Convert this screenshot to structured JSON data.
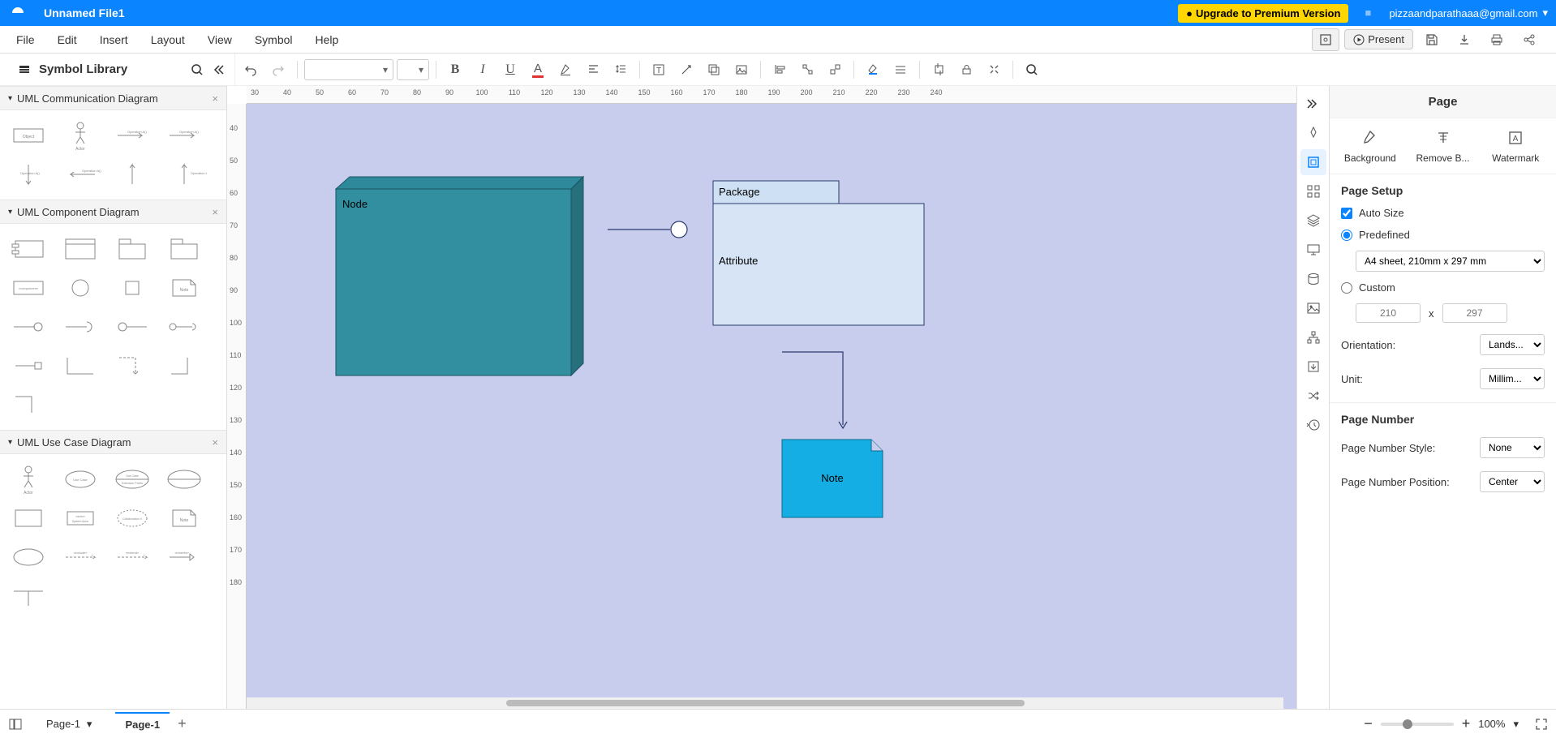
{
  "app": {
    "file_title": "Unnamed File1",
    "upgrade_label": "Upgrade to Premium Version",
    "user_email": "pizzaandparathaaa@gmail.com"
  },
  "menus": [
    "File",
    "Edit",
    "Insert",
    "Layout",
    "View",
    "Symbol",
    "Help"
  ],
  "present_label": "Present",
  "symbol_library_title": "Symbol Library",
  "shape_groups": [
    {
      "title": "UML Communication Diagram"
    },
    {
      "title": "UML Component Diagram"
    },
    {
      "title": "UML Use Case Diagram"
    }
  ],
  "canvas": {
    "ruler_h": [
      30,
      40,
      50,
      60,
      70,
      80,
      90,
      100,
      110,
      120,
      130,
      140,
      150,
      160,
      170,
      180,
      190,
      200,
      210,
      220,
      230,
      240
    ],
    "ruler_v": [
      40,
      50,
      60,
      70,
      80,
      90,
      100,
      110,
      120,
      130,
      140,
      150,
      160,
      170,
      180
    ],
    "shapes": {
      "node_label": "Node",
      "package_label": "Package",
      "attribute_label": "Attribute",
      "note_label": "Note"
    }
  },
  "right_panel": {
    "title": "Page",
    "tabs": {
      "bg": "Background",
      "remove": "Remove B...",
      "watermark": "Watermark"
    },
    "page_setup_title": "Page Setup",
    "auto_size": "Auto Size",
    "predefined": "Predefined",
    "predefined_value": "A4 sheet, 210mm x 297 mm",
    "custom": "Custom",
    "width_ph": "210",
    "height_ph": "297",
    "x_label": "x",
    "orientation_label": "Orientation:",
    "orientation_value": "Lands...",
    "unit_label": "Unit:",
    "unit_value": "Millim...",
    "page_number_title": "Page Number",
    "pn_style_label": "Page Number Style:",
    "pn_style_value": "None",
    "pn_pos_label": "Page Number Position:",
    "pn_pos_value": "Center"
  },
  "status": {
    "page_select": "Page-1",
    "page_tab": "Page-1",
    "zoom": "100%"
  }
}
